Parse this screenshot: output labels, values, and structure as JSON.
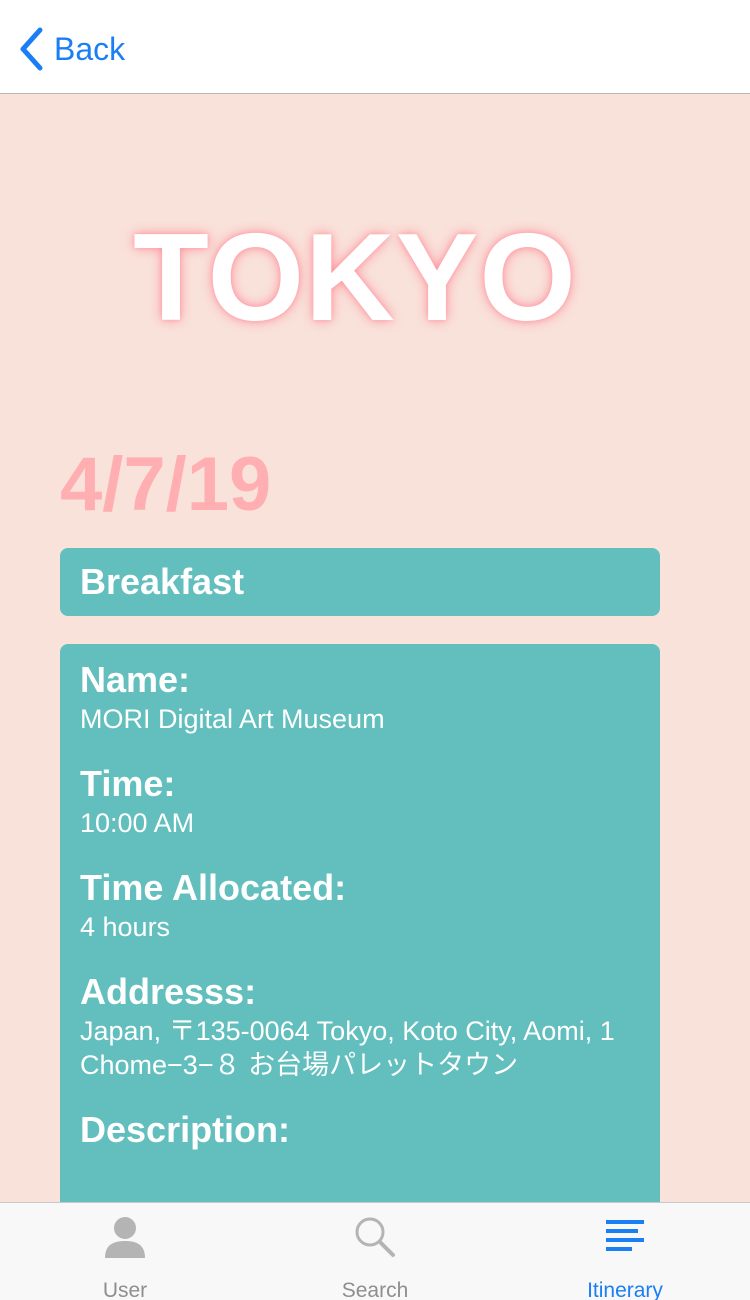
{
  "nav": {
    "back_label": "Back"
  },
  "city": "TOKYO",
  "date": "4/7/19",
  "section": "Breakfast",
  "details": {
    "name_label": "Name:",
    "name_value": "MORI Digital Art Museum",
    "time_label": "Time:",
    "time_value": "10:00 AM",
    "alloc_label": "Time Allocated:",
    "alloc_value": "4 hours",
    "address_label": "Addresss:",
    "address_value": "Japan, 〒135-0064 Tokyo, Koto City, Aomi, 1 Chome−3−８ お台場パレットタウン",
    "description_label": "Description:"
  },
  "tabs": [
    {
      "label": "User",
      "icon": "user-icon",
      "active": false
    },
    {
      "label": "Search",
      "icon": "search-icon",
      "active": false
    },
    {
      "label": "Itinerary",
      "icon": "itinerary-list-icon",
      "active": true
    }
  ],
  "colors": {
    "accent": "#1a7ff5",
    "background": "#f9e2da",
    "card": "#62bfbe",
    "date": "#ffaeb2"
  }
}
